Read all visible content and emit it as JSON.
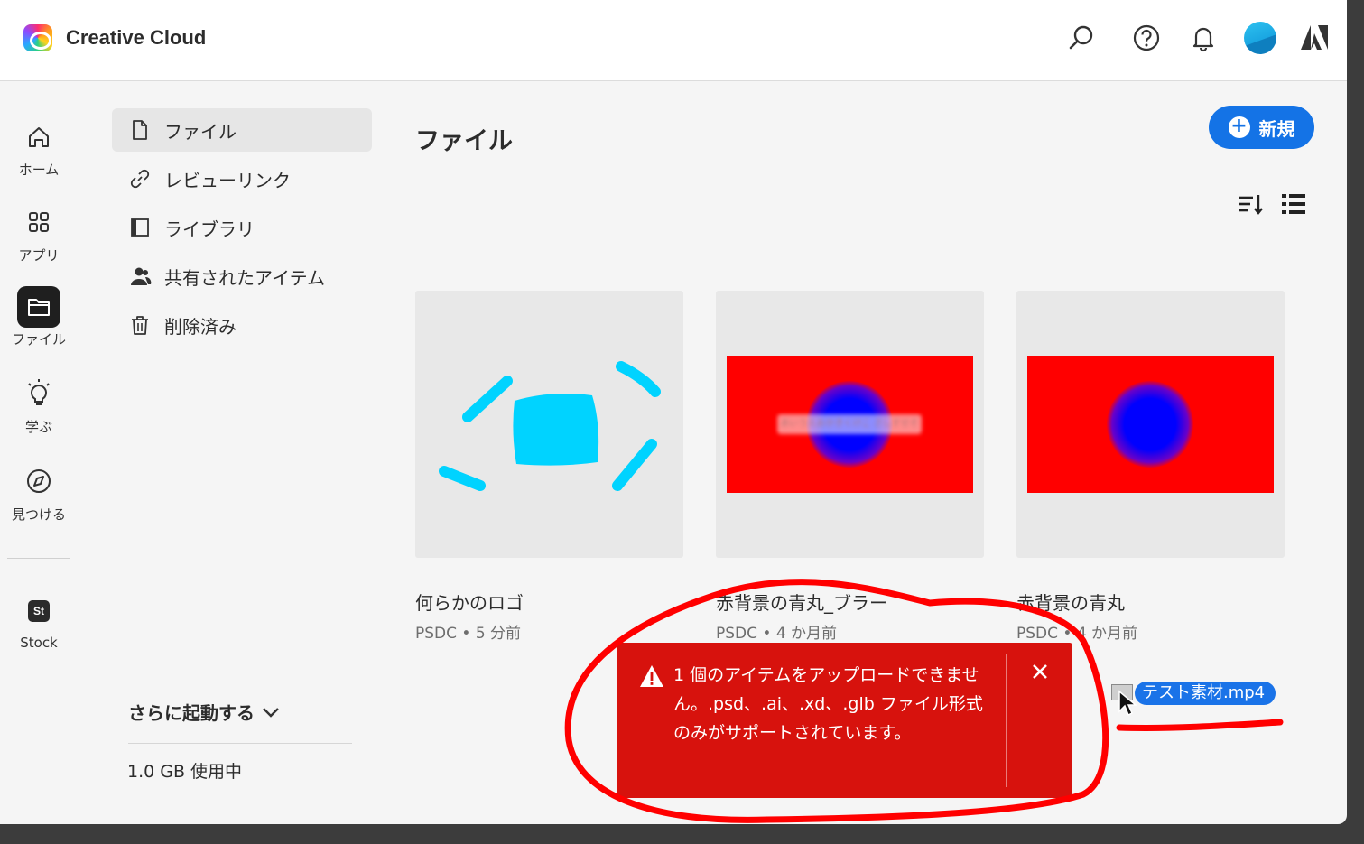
{
  "header": {
    "title": "Creative Cloud",
    "icons": [
      "search-icon",
      "help-icon",
      "bell-icon",
      "avatar",
      "adobe-logo"
    ]
  },
  "rail": {
    "items": [
      {
        "label": "ホーム",
        "icon": "home-icon"
      },
      {
        "label": "アプリ",
        "icon": "apps-icon"
      },
      {
        "label": "ファイル",
        "icon": "folder-icon"
      },
      {
        "label": "学ぶ",
        "icon": "lightbulb-icon"
      },
      {
        "label": "見つける",
        "icon": "compass-icon"
      }
    ],
    "stock": {
      "badge": "St",
      "label": "Stock"
    }
  },
  "sidenav": {
    "items": [
      {
        "label": "ファイル",
        "icon": "file-icon"
      },
      {
        "label": "レビューリンク",
        "icon": "link-icon"
      },
      {
        "label": "ライブラリ",
        "icon": "library-icon"
      },
      {
        "label": "共有されたアイテム",
        "icon": "people-icon"
      },
      {
        "label": "削除済み",
        "icon": "trash-icon"
      }
    ],
    "launch_more": "さらに起動する",
    "storage": "1.0 GB 使用中"
  },
  "main": {
    "title": "ファイル",
    "new_button": "新規",
    "blur_text": "あいうえおかきくけこ さしすせそ",
    "files": [
      {
        "name": "何らかのロゴ",
        "meta": "PSDC • 5 分前"
      },
      {
        "name": "赤背景の青丸_ブラー",
        "meta": "PSDC • 4 か月前"
      },
      {
        "name": "赤背景の青丸",
        "meta": "PSDC • 4 か月前"
      }
    ]
  },
  "toast": {
    "message": "1 個のアイテムをアップロードできません。.psd、.ai、.xd、.glb ファイル形式のみがサポートされています。",
    "color": "#d7120d"
  },
  "drag": {
    "filename": "テスト素材.mp4"
  },
  "colors": {
    "accent": "#1473e6",
    "error": "#d7120d",
    "annotation": "#ff0000"
  }
}
